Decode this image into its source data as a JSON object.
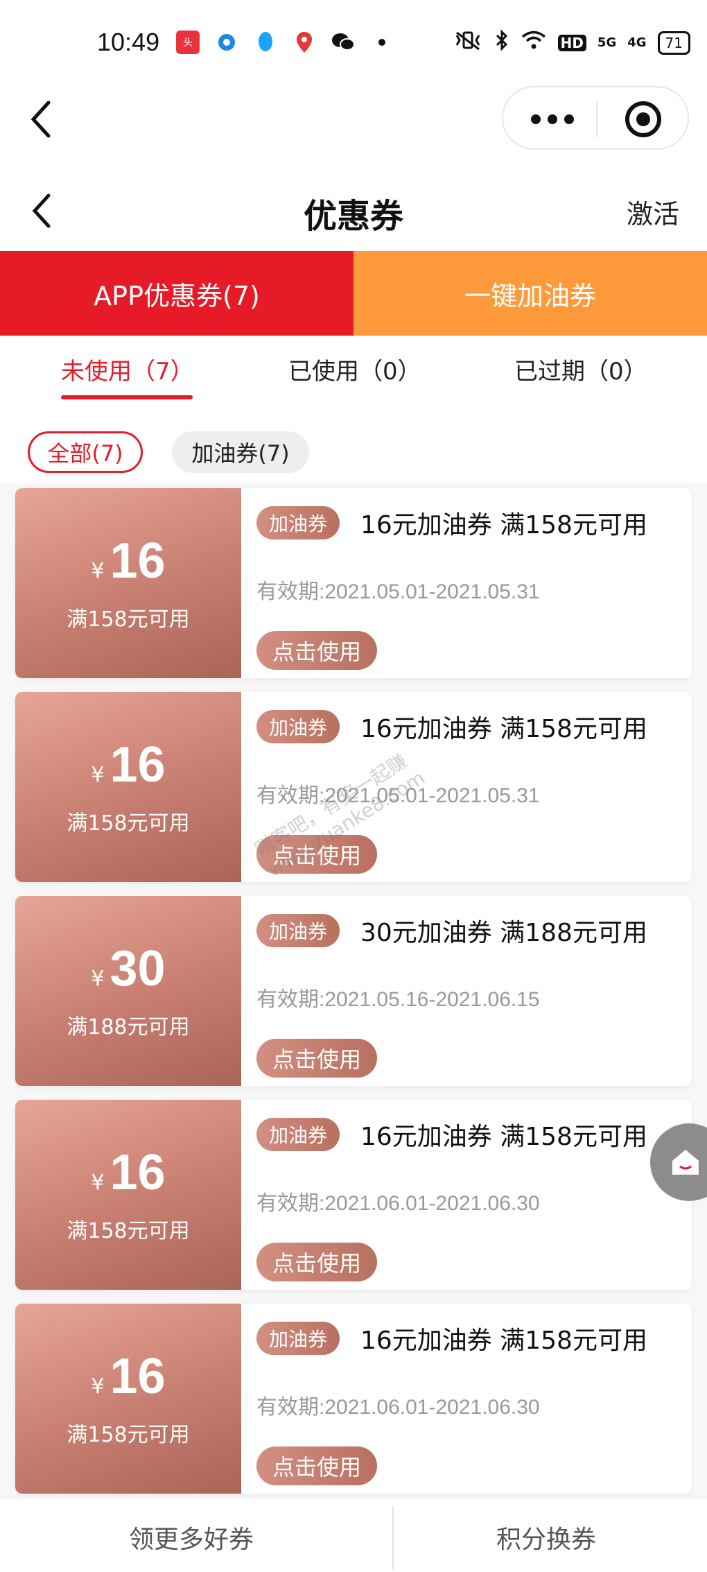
{
  "status_bar": {
    "time": "10:49",
    "left_icons": [
      "toutiao-icon",
      "circle-app-icon",
      "qq-icon",
      "maps-pin-icon",
      "wechat-icon",
      "dot-icon"
    ],
    "right_icons": [
      "mute-vibrate-icon",
      "bluetooth-icon",
      "wifi-icon",
      "hd-icon",
      "5g-signal-icon",
      "4g-signal-icon"
    ],
    "hd_label": "HD",
    "signal_5g": "5G",
    "signal_4g": "4G",
    "battery": "71"
  },
  "nav": {
    "title": "优惠券",
    "action": "激活"
  },
  "segments": {
    "app": "APP优惠券(7)",
    "oil": "一键加油券"
  },
  "status_tabs": {
    "unused": "未使用（7）",
    "used": "已使用（0）",
    "expired": "已过期（0）"
  },
  "filters": {
    "all": "全部(7)",
    "oil": "加油券(7)"
  },
  "coupons": [
    {
      "yen": "¥",
      "amount": "16",
      "min": "满158元可用",
      "tag": "加油券",
      "title": "16元加油券 满158元可用",
      "validity": "有效期:2021.05.01-2021.05.31",
      "button": "点击使用"
    },
    {
      "yen": "¥",
      "amount": "16",
      "min": "满158元可用",
      "tag": "加油券",
      "title": "16元加油券 满158元可用",
      "validity": "有效期:2021.05.01-2021.05.31",
      "button": "点击使用"
    },
    {
      "yen": "¥",
      "amount": "30",
      "min": "满188元可用",
      "tag": "加油券",
      "title": "30元加油券 满188元可用",
      "validity": "有效期:2021.05.16-2021.06.15",
      "button": "点击使用"
    },
    {
      "yen": "¥",
      "amount": "16",
      "min": "满158元可用",
      "tag": "加油券",
      "title": "16元加油券 满158元可用",
      "validity": "有效期:2021.06.01-2021.06.30",
      "button": "点击使用"
    },
    {
      "yen": "¥",
      "amount": "16",
      "min": "满158元可用",
      "tag": "加油券",
      "title": "16元加油券 满158元可用",
      "validity": "有效期:2021.06.01-2021.06.30",
      "button": "点击使用"
    }
  ],
  "watermark": {
    "line1": "赚客吧，有奖一起赚",
    "line2": "www.zuanke8.com"
  },
  "bottom_bar": {
    "left": "领更多好券",
    "right": "积分换券"
  },
  "colors": {
    "primary_red": "#e61b27",
    "orange": "#ff9a3c",
    "coupon_brown": "#c77e70"
  }
}
